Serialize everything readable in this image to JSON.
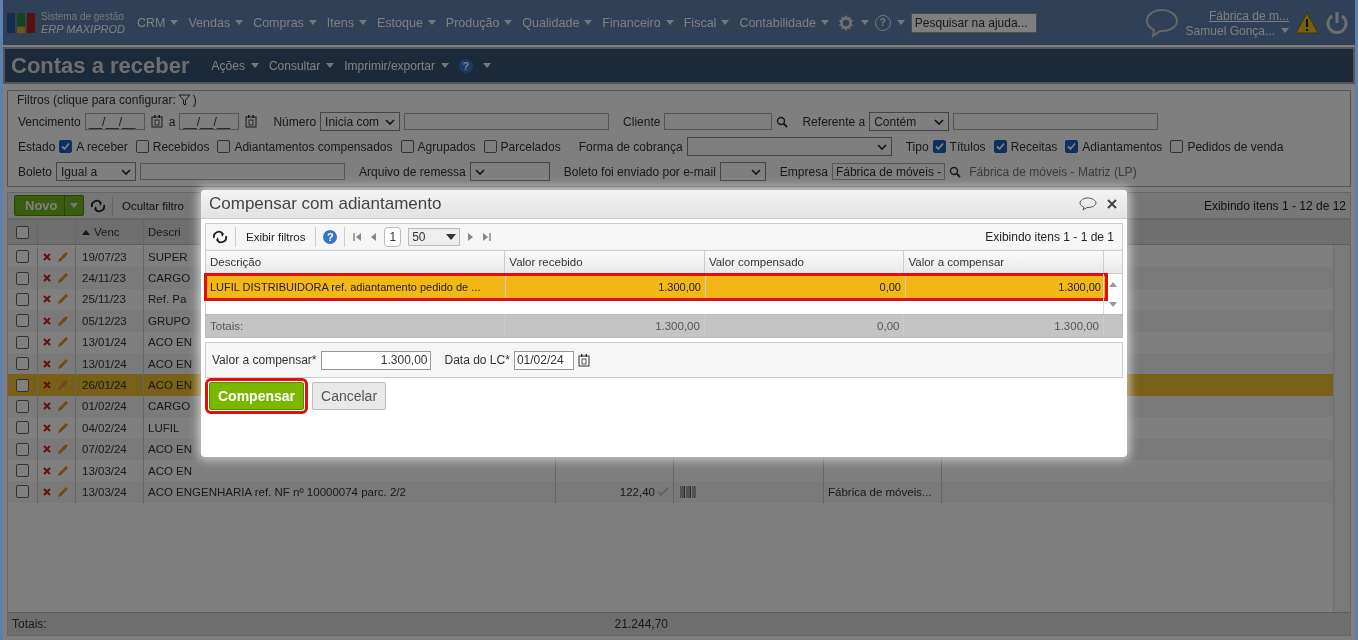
{
  "header": {
    "brand_top": "Sistema de gestão",
    "brand_name": "ERP MAXIPROD",
    "menu": [
      {
        "label": "CRM"
      },
      {
        "label": "Vendas"
      },
      {
        "label": "Compras"
      },
      {
        "label": "Itens"
      },
      {
        "label": "Estoque"
      },
      {
        "label": "Produção"
      },
      {
        "label": "Qualidade"
      },
      {
        "label": "Financeiro"
      },
      {
        "label": "Fiscal"
      },
      {
        "label": "Contabilidade"
      }
    ],
    "help_icon": "?",
    "help_search": {
      "placeholder": "Pesquisar na ajuda..."
    },
    "company": "Fábrica de m...",
    "user": "Samuel Gonça..."
  },
  "page": {
    "title": "Contas a receber",
    "actions": [
      "Ações",
      "Consultar",
      "Imprimir/exportar"
    ],
    "help_icon": "?"
  },
  "filters": {
    "legend": "Filtros (clique para configurar:",
    "legend_end": ")",
    "due_label": "Vencimento",
    "due_from": "__/__/__",
    "due_sep": "a",
    "due_to": "__/__/__",
    "number_label": "Número",
    "number_op": "Inicia com",
    "client_label": "Cliente",
    "ref_label": "Referente a",
    "ref_op": "Contém",
    "state_label": "Estado",
    "states": [
      {
        "label": "A receber",
        "checked": true
      },
      {
        "label": "Recebidos",
        "checked": false
      },
      {
        "label": "Adiantamentos compensados",
        "checked": false
      },
      {
        "label": "Agrupados",
        "checked": false
      },
      {
        "label": "Parcelados",
        "checked": false
      }
    ],
    "billing_label": "Forma de cobrança",
    "type_label": "Tipo",
    "types": [
      {
        "label": "Títulos",
        "checked": true
      },
      {
        "label": "Receitas",
        "checked": true
      },
      {
        "label": "Adiantamentos",
        "checked": true
      },
      {
        "label": "Pedidos de venda",
        "checked": false
      }
    ],
    "slip_label": "Boleto",
    "slip_op": "Igual a",
    "remittance_label": "Arquivo de remessa",
    "emailed_label": "Boleto foi enviado por e-mail",
    "company_label": "Empresa",
    "company_value": "Fábrica de móveis -",
    "company_name": "Fábrica de móveis - Matriz (LP)"
  },
  "toolbar": {
    "new_button": "Novo",
    "hide_filters": "Ocultar filtro",
    "count": "Exibindo itens 1 - 12 de 12"
  },
  "grid": {
    "select_all_checked": false,
    "columns": [
      "Venc",
      "Descri"
    ],
    "rows": [
      {
        "due": "19/07/23",
        "desc": "SUPER",
        "selected": false
      },
      {
        "due": "24/11/23",
        "desc": "CARGO",
        "selected": false
      },
      {
        "due": "25/11/23",
        "desc": "Ref. Pa",
        "selected": false
      },
      {
        "due": "05/12/23",
        "desc": "GRUPO",
        "selected": false
      },
      {
        "due": "13/01/24",
        "desc": "ACO EN",
        "selected": false
      },
      {
        "due": "13/01/24",
        "desc": "ACO EN",
        "selected": false
      },
      {
        "due": "26/01/24",
        "desc": "ACO EN",
        "selected": true
      },
      {
        "due": "01/02/24",
        "desc": "CARGO",
        "selected": false
      },
      {
        "due": "04/02/24",
        "desc": "LUFIL",
        "selected": false
      },
      {
        "due": "07/02/24",
        "desc": "ACO EN",
        "selected": false
      },
      {
        "due": "13/03/24",
        "desc": "ACO EN",
        "selected": false
      },
      {
        "due": "13/03/24",
        "desc": "ACO ENGENHARIA ref. NF nº 10000074 parc. 2/2",
        "value": "122,40",
        "company": "Fábrica de móveis...",
        "selected": false
      }
    ],
    "totals": {
      "label": "Totais:",
      "value": "21.244,70"
    }
  },
  "dialog": {
    "title": "Compensar com adiantamento",
    "show_filters": "Exibir filtros",
    "help_icon": "?",
    "page": "1",
    "page_size": "50",
    "count": "Exibindo itens 1 - 1 de 1",
    "columns": [
      "Descrição",
      "Valor recebido",
      "Valor compensado",
      "Valor a compensar"
    ],
    "rows": [
      {
        "cells": [
          "LUFIL DISTRIBUIDORA ref. adiantamento pedido de ...",
          "1.300,00",
          "0,00",
          "1.300,00"
        ],
        "selected": true,
        "highlighted": true
      }
    ],
    "totals": [
      "Totais:",
      "1.300,00",
      "0,00",
      "1.300,00"
    ],
    "amount_label": "Valor a compensar*",
    "amount": "1.300,00",
    "date_label": "Data do LC*",
    "date": "01/02/24",
    "buttons": [
      {
        "label": "Compensar",
        "kind": "primary",
        "highlighted": true
      },
      {
        "label": "Cancelar",
        "kind": "secondary",
        "highlighted": false
      }
    ]
  }
}
